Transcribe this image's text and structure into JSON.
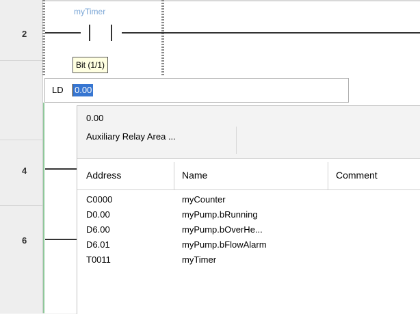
{
  "ladder": {
    "row_numbers": [
      "2",
      "4",
      "6"
    ],
    "contact_name": "myTimer",
    "tooltip": "Bit (1/1)"
  },
  "instruction_input": {
    "mnemonic": "LD",
    "value": "0.00"
  },
  "autocomplete": {
    "selected_address": "0.00",
    "selected_area": "Auxiliary Relay Area ...",
    "columns": [
      "Address",
      "Name",
      "Comment"
    ],
    "rows": [
      {
        "address": "C0000",
        "name": "myCounter",
        "comment": ""
      },
      {
        "address": "D0.00",
        "name": "myPump.bRunning",
        "comment": ""
      },
      {
        "address": "D6.00",
        "name": "myPump.bOverHe...",
        "comment": ""
      },
      {
        "address": "D6.01",
        "name": "myPump.bFlowAlarm",
        "comment": ""
      },
      {
        "address": "T0011",
        "name": "myTimer",
        "comment": ""
      }
    ]
  }
}
